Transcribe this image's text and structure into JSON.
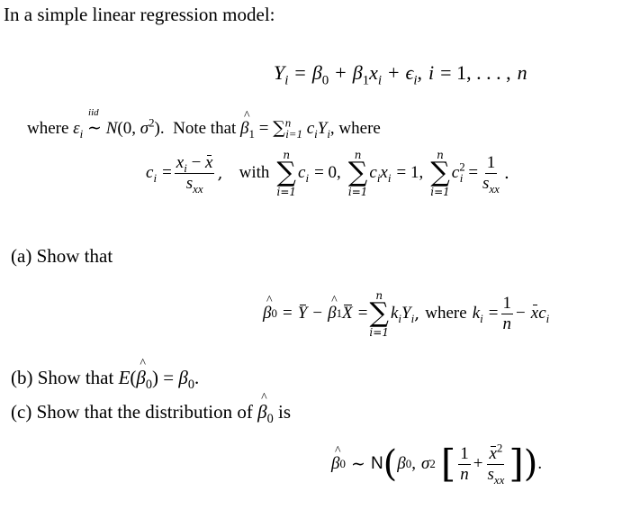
{
  "intro": {
    "text": "In a simple linear regression model:"
  },
  "model_equation": {
    "text": "Yᵢ = β₀ + β₁xᵢ + εᵢ, i = 1, . . . , n"
  },
  "assumption": {
    "where": "where",
    "epsilon": "ε",
    "iid": "iid",
    "dist": "N(0, σ²).",
    "note": "Note that",
    "sum_part": "= ∑",
    "sum_upper": "n",
    "sum_lower": "i=1",
    "ciyi": "cᵢYᵢ,",
    "where2": "where"
  },
  "ci_definition": {
    "lhs": "cᵢ =",
    "num": "xᵢ − x̄",
    "den": "sₓₓ",
    "with": "with",
    "cond1": "cᵢ = 0,",
    "cond2": "cᵢxᵢ = 1,",
    "cond3": "cᵢ² =",
    "cond3_num": "1",
    "cond3_den": "sₓₓ",
    "sum_upper": "n",
    "sum_lower": "i=1"
  },
  "parts": [
    {
      "label": "(a)",
      "text": "Show that"
    },
    {
      "label": "(b)",
      "text": "Show that E(β̂₀) = β₀."
    },
    {
      "label": "(c)",
      "text": "Show that the distribution of β̂₀ is"
    }
  ],
  "part_a_equation": {
    "lhs": "β̂₀ = Ȳ − β̂₁X̄ =",
    "sum_upper": "n",
    "sum_lower": "i=1",
    "term": "kᵢYᵢ,",
    "where": "where",
    "ki": "kᵢ =",
    "frac_num": "1",
    "frac_den": "n",
    "tail": "− x̄cᵢ"
  },
  "part_c_equation": {
    "lhs": "β̂₀ ∼",
    "N": "N",
    "beta0": "β₀,",
    "sigma2": "σ²",
    "f1_num": "1",
    "f1_den": "n",
    "plus": "+",
    "f2_num": "x̄²",
    "f2_den": "sₓₓ",
    "end": "."
  }
}
